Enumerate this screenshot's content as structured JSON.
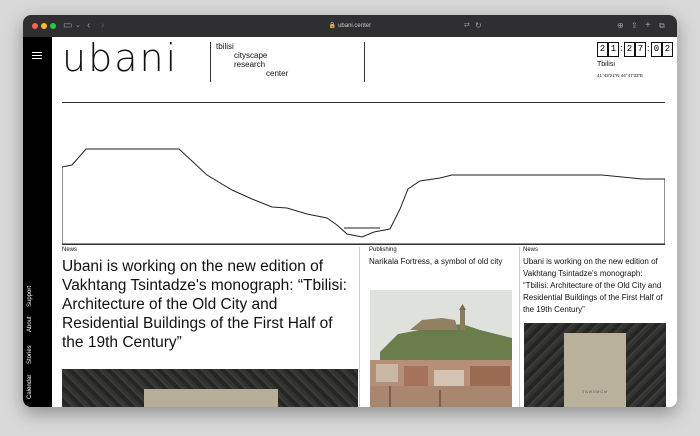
{
  "browser": {
    "url": "ubani.center",
    "lock_icon": "lock-icon"
  },
  "sidebar": {
    "nav": [
      "Calendar",
      "Stories",
      "About",
      "Support"
    ]
  },
  "header": {
    "logo": "ubani",
    "tagline": [
      "tbilisi",
      "cityscape",
      "research",
      "center"
    ],
    "clock_digits": [
      "2",
      "1",
      "2",
      "7",
      "0",
      "2"
    ],
    "city": "Tbilisi",
    "coordinates": "41°43'21\"N 44°47'33\"E"
  },
  "cards": [
    {
      "label": "News",
      "title": "Ubani is working on the new edition of Vakhtang Tsintadze's monograph: “Tbilisi: Architecture of the Old City and Residential Buildings of the First Half of the 19th Century”"
    },
    {
      "label": "Publishing",
      "title": "Narikala Fortress, a symbol of old city"
    },
    {
      "label": "News",
      "title": "Ubani is working on the new edition of Vakhtang Tsintadze's monograph: “Tbilisi: Architecture of the Old City and Residential Buildings of the First Half of the 19th Century”"
    }
  ],
  "book_spine_text": "ТБИЛИСИ",
  "colors": {
    "sidebar": "#000000",
    "titlebar": "#2f2f31",
    "close": "#ff5f57",
    "minimize": "#febc2e",
    "zoom": "#28c840"
  }
}
